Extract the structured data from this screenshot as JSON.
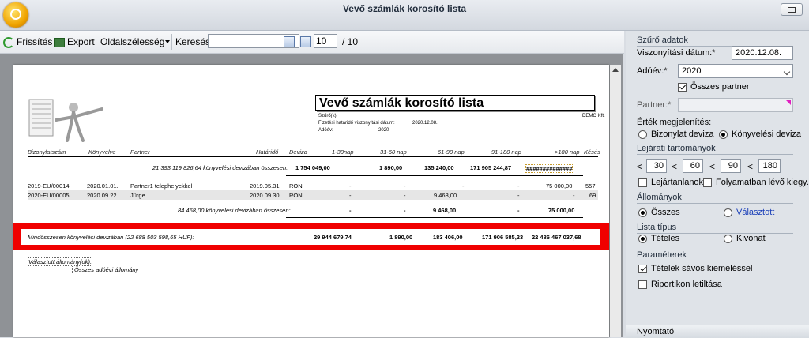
{
  "window": {
    "title": "Vevő számlák korosító lista"
  },
  "toolbar": {
    "refresh": "Frissítés",
    "export": "Export",
    "zoom": "Oldalszélesség",
    "search_label": "Keresés:",
    "search_value": "",
    "page_current": "10",
    "page_total": "/ 10"
  },
  "report": {
    "title": "Vevő számlák korosító lista",
    "filter_label": "Szűrő(k):",
    "filter_line1_label": "Fizetési határidő viszonyítási dátum:",
    "filter_line1_value": "2020.12.08.",
    "filter_line2_label": "Adóév:",
    "filter_line2_value": "2020",
    "company": "DEMO Kft.",
    "columns": [
      "Bizonylatszám",
      "Könyvelve",
      "Partner",
      "Határidő",
      "Deviza",
      "1-30nap",
      "31-60 nap",
      "61-90 nap",
      "91-180 nap",
      ">180 nap",
      "Késés"
    ],
    "subtotal1": {
      "label": "21 393 119 826,64 könyvelési devizában összesen:",
      "v1": "1 754 049,00",
      "v2": "1 890,00",
      "v3": "135 240,00",
      "v4": "171 905 244,87",
      "v5": "##############"
    },
    "rows": [
      {
        "doc": "2019-EU/00014",
        "booked": "2020.01.01.",
        "partner": "Partner1 telephelyekkel",
        "due": "2019.05.31.",
        "cur": "RON",
        "v1": "-",
        "v2": "-",
        "v3": "-",
        "v4": "-",
        "v5": "75 000,00",
        "late": "557"
      },
      {
        "doc": "2020-EU/00005",
        "booked": "2020.09.22.",
        "partner": "Jürge",
        "due": "2020.09.30.",
        "cur": "RON",
        "v1": "-",
        "v2": "-",
        "v3": "9 468,00",
        "v4": "-",
        "v5": "-",
        "late": "69"
      }
    ],
    "subtotal2": {
      "label": "84 468,00 könyvelési devizában összesen:",
      "v1": "-",
      "v2": "-",
      "v3": "9 468,00",
      "v4": "-",
      "v5": "75 000,00"
    },
    "grand": {
      "label": "Mindösszesen könyvelési devizában (22 688 503 598,65 HUF):",
      "v1": "29 944 679,74",
      "v2": "1 890,00",
      "v3": "183 406,00",
      "v4": "171 906 585,23",
      "v5": "22 486 467 037,68"
    },
    "selected_state_label": "Választott állomány(ok):",
    "selected_state_value": "Összes adóévi állomány"
  },
  "panel": {
    "filter_title": "Szűrő adatok",
    "ref_date_label": "Viszonyítási dátum:*",
    "ref_date_value": "2020.12.08.",
    "tax_year_label": "Adóév:*",
    "tax_year_value": "2020",
    "all_partners": "Összes partner",
    "partner_label": "Partner:*",
    "value_display_label": "Érték megjelenítés:",
    "opt_doc_currency": "Bizonylat deviza",
    "opt_book_currency": "Könyvelési deviza",
    "ranges_title": "Lejárati tartományok",
    "range_sign": "<",
    "range_values": [
      "30",
      "60",
      "90",
      "180"
    ],
    "overdue_label": "Lejártanlanok is",
    "in_progress_label": "Folyamatban lévő kiegy. is",
    "stocks_title": "Állományok",
    "opt_all": "Összes",
    "opt_selected": "Választott",
    "list_type_title": "Lista típus",
    "opt_itemized": "Tételes",
    "opt_extract": "Kivonat",
    "params_title": "Paraméterek",
    "param_stripes": "Tételek sávos kiemeléssel",
    "param_disable": "Riportikon letiltása",
    "printer": "Nyomtató"
  }
}
